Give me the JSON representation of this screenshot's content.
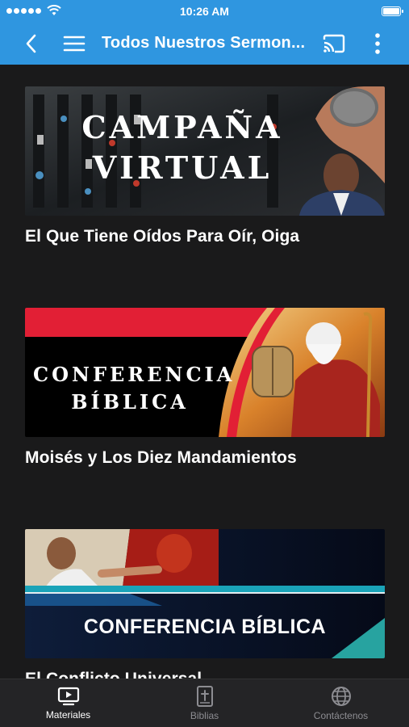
{
  "status_bar": {
    "time": "10:26 AM"
  },
  "app_bar": {
    "title": "Todos Nuestros Sermon..."
  },
  "items": [
    {
      "caption": "El Que Tiene Oídos Para Oír, Oiga",
      "banner_lines": [
        "CAMPAÑA",
        "VIRTUAL"
      ]
    },
    {
      "caption": "Moisés y Los Diez Mandamientos",
      "banner_lines": [
        "CONFERENCIA",
        "BÍBLICA"
      ]
    },
    {
      "caption": "El Conflicto Universal",
      "banner_lines": [
        "CONFERENCIA BÍBLICA"
      ]
    }
  ],
  "tabs": [
    {
      "label": "Materiales",
      "icon": "tv-icon",
      "active": true
    },
    {
      "label": "Biblias",
      "icon": "bible-icon",
      "active": false
    },
    {
      "label": "Contáctenos",
      "icon": "globe-icon",
      "active": false
    }
  ],
  "colors": {
    "app_bar": "#2f96e0",
    "background": "#1a1a1b",
    "tab_bar": "#242426"
  }
}
